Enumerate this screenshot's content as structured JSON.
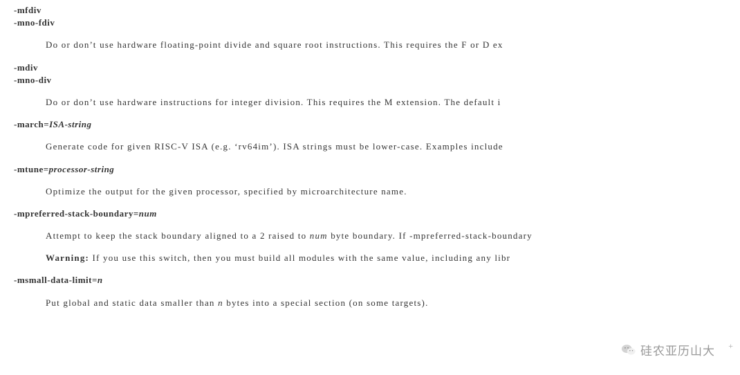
{
  "entries": [
    {
      "options": [
        {
          "flag": "-mfdiv",
          "param": ""
        },
        {
          "flag": "-mno-fdiv",
          "param": ""
        }
      ],
      "paragraphs": [
        {
          "pre": "Do or don’t use hardware floating-point divide and square root instructions. This requires the F or D ex",
          "ital": "",
          "post": ""
        }
      ]
    },
    {
      "options": [
        {
          "flag": "-mdiv",
          "param": ""
        },
        {
          "flag": "-mno-div",
          "param": ""
        }
      ],
      "paragraphs": [
        {
          "pre": "Do or don’t use hardware instructions for integer division. This requires the M extension. The default i",
          "ital": "",
          "post": ""
        }
      ]
    },
    {
      "options": [
        {
          "flag": "-march=",
          "param": "ISA-string"
        }
      ],
      "paragraphs": [
        {
          "pre": "Generate code for given RISC-V ISA (e.g.  ‘rv64im’). ISA strings must be lower-case. Examples include",
          "ital": "",
          "post": ""
        }
      ]
    },
    {
      "options": [
        {
          "flag": "-mtune=",
          "param": "processor-string"
        }
      ],
      "paragraphs": [
        {
          "pre": "Optimize the output for the given processor, specified by microarchitecture name.",
          "ital": "",
          "post": ""
        }
      ]
    },
    {
      "options": [
        {
          "flag": "-mpreferred-stack-boundary=",
          "param": "num"
        }
      ],
      "paragraphs": [
        {
          "pre": "Attempt to keep the stack boundary aligned to a 2 raised to ",
          "ital": "num",
          "post": " byte boundary. If -mpreferred-stack-boundary"
        },
        {
          "warn": "Warning:",
          "pre": " If you use this switch, then you must build all modules with the same value, including any libr",
          "ital": "",
          "post": ""
        }
      ]
    },
    {
      "options": [
        {
          "flag": "-msmall-data-limit=",
          "param": "n"
        }
      ],
      "paragraphs": [
        {
          "pre": "Put global and static data smaller than ",
          "ital": "n",
          "post": " bytes into a special section (on some targets)."
        }
      ]
    }
  ],
  "watermark": "硅农亚历山大",
  "plus": "+"
}
